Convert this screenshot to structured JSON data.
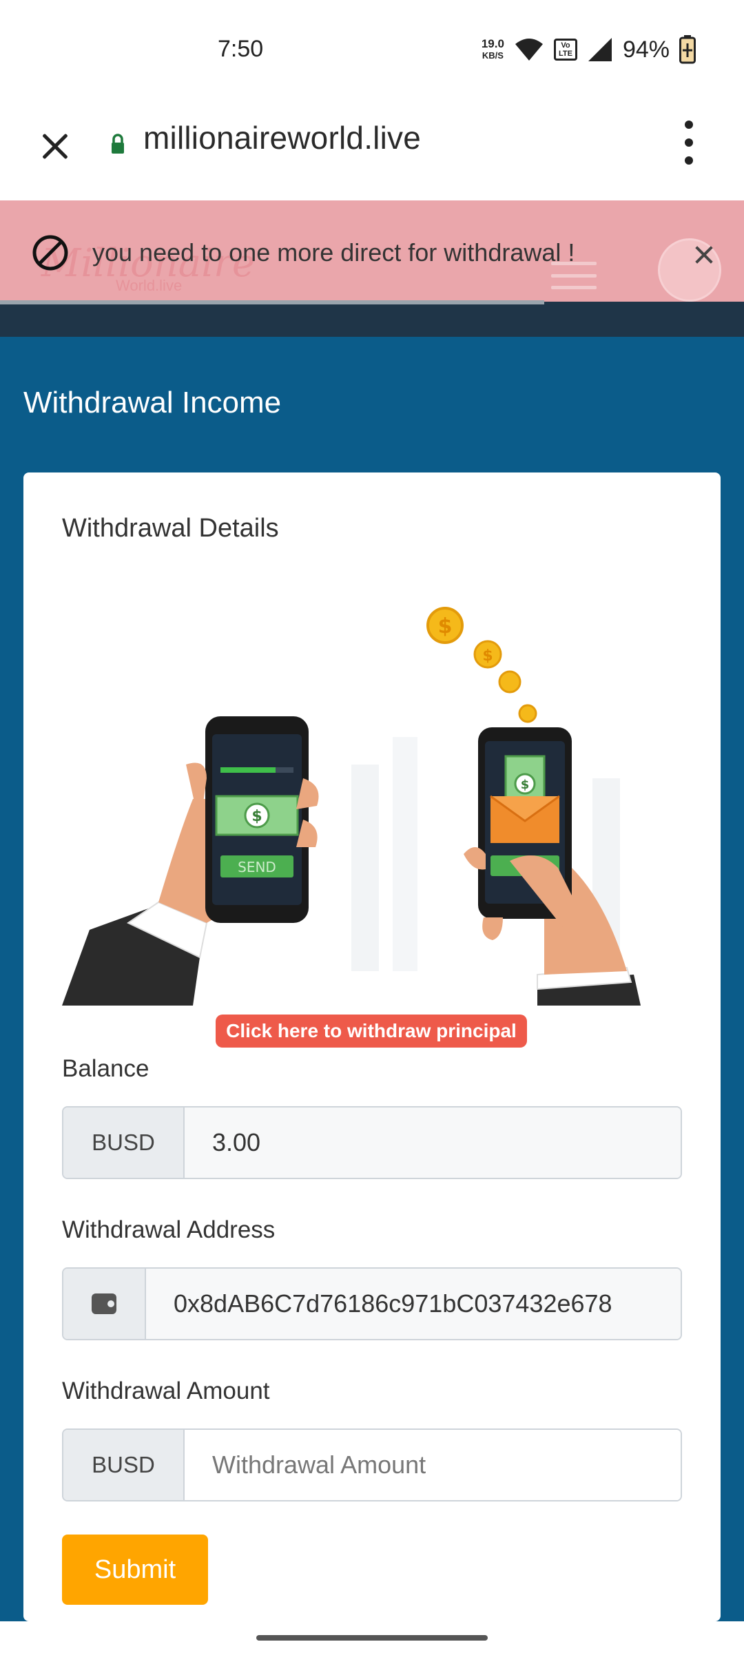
{
  "status_bar": {
    "time": "7:50",
    "net_speed_value": "19.0",
    "net_speed_unit": "KB/S",
    "volte_top": "Vo",
    "volte_bottom": "LTE",
    "battery_percent": "94%"
  },
  "browser": {
    "url": "millionaireworld.live"
  },
  "header": {
    "logo_text": "Millionaire",
    "logo_sub": "World.live"
  },
  "alert": {
    "message": "you need to one more direct for withdrawal !"
  },
  "page": {
    "title": "Withdrawal Income"
  },
  "card": {
    "title": "Withdrawal Details",
    "illustration": {
      "send_label": "SEND"
    },
    "principal_link": "Click here to withdraw principal",
    "balance": {
      "label": "Balance",
      "currency": "BUSD",
      "value": "3.00"
    },
    "address": {
      "label": "Withdrawal Address",
      "value": "0x8dAB6C7d76186c971bC037432e678"
    },
    "amount": {
      "label": "Withdrawal Amount",
      "currency": "BUSD",
      "placeholder": "Withdrawal Amount"
    },
    "submit_label": "Submit"
  },
  "colors": {
    "main_bg": "#0b5c8a",
    "alert_bg": "#eaa6ab",
    "submit": "#ffa500",
    "link_badge": "#ee5a4a"
  }
}
